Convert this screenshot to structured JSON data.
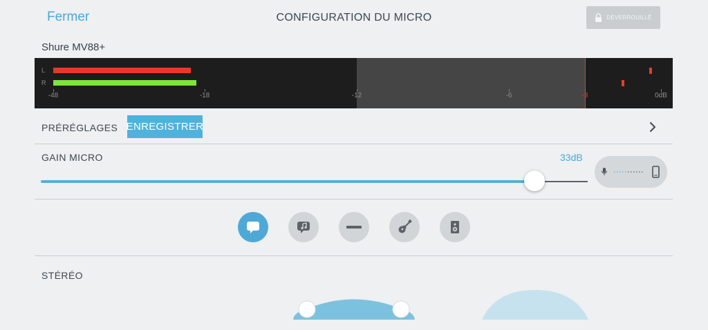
{
  "header": {
    "close_label": "Fermer",
    "title": "CONFIGURATION DU MICRO",
    "lock_label": "DÉVERROUILLÉ",
    "lock_icon": "padlock-icon"
  },
  "device": {
    "name": "Shure MV88+"
  },
  "meter": {
    "channels": [
      {
        "label": "L",
        "level_db": -20.8,
        "peak_db": -0.4,
        "color": "#e8382b"
      },
      {
        "label": "R",
        "level_db": -19.6,
        "peak_db": -1.5,
        "color": "#7ee63a"
      }
    ],
    "ticks": [
      "-48",
      "-18",
      "-12",
      "-6",
      "-3",
      "0dB"
    ],
    "target_zone_db": [
      -12,
      -3
    ],
    "limit_db": -3
  },
  "presets": {
    "label": "PRÉRÉGLAGES",
    "selected": "ENREGISTRER",
    "chevron_icon": "chevron-right-icon"
  },
  "gain": {
    "label": "GAIN MICRO",
    "value_label": "33dB",
    "fraction": 0.9,
    "monitor_icons": [
      "microphone-icon",
      "phone-icon"
    ]
  },
  "modes": [
    {
      "name": "speech",
      "icon": "speech-bubble-icon",
      "active": true
    },
    {
      "name": "singing",
      "icon": "music-bubble-icon",
      "active": false
    },
    {
      "name": "flat",
      "icon": "flat-line-icon",
      "active": false
    },
    {
      "name": "acoustic",
      "icon": "guitar-icon",
      "active": false
    },
    {
      "name": "loud",
      "icon": "speaker-icon",
      "active": false
    }
  ],
  "stereo": {
    "label": "STÉRÉO"
  },
  "colors": {
    "accent": "#4fb2dc",
    "background": "#eef0f1",
    "meter_bg": "#1d1d1d",
    "limit": "#e13f2d"
  }
}
